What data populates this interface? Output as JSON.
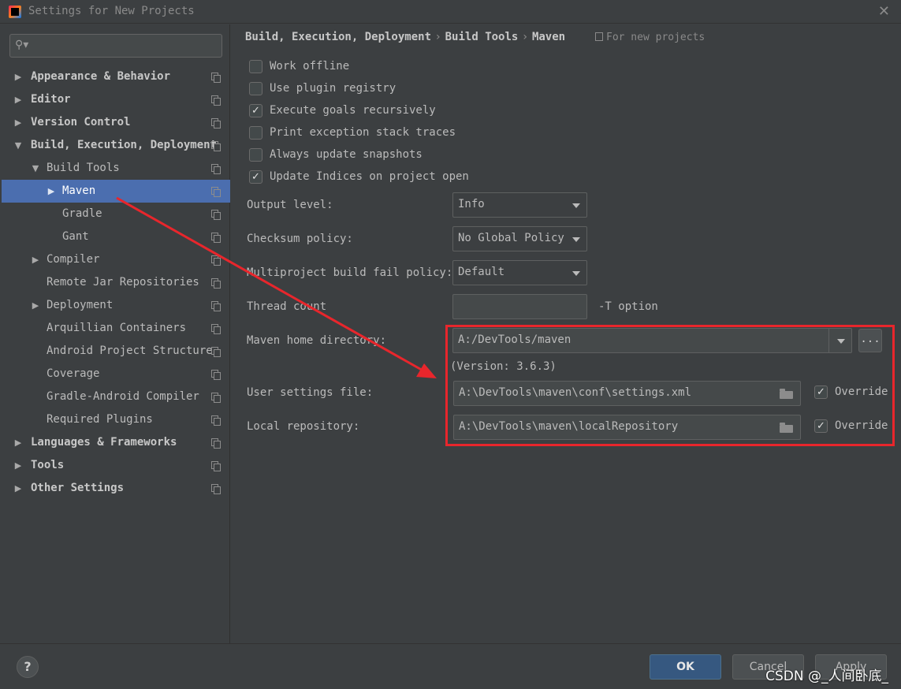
{
  "window": {
    "title": "Settings for New Projects",
    "close_glyph": "✕"
  },
  "sidebar": {
    "search_placeholder": "",
    "items": [
      {
        "label": "Appearance & Behavior",
        "arrow": "▶"
      },
      {
        "label": "Editor",
        "arrow": "▶"
      },
      {
        "label": "Version Control",
        "arrow": "▶"
      },
      {
        "label": "Build, Execution, Deployment",
        "arrow": "▼"
      },
      {
        "label": "Build Tools",
        "arrow": "▼"
      },
      {
        "label": "Maven",
        "arrow": "▶"
      },
      {
        "label": "Gradle",
        "arrow": ""
      },
      {
        "label": "Gant",
        "arrow": ""
      },
      {
        "label": "Compiler",
        "arrow": "▶"
      },
      {
        "label": "Remote Jar Repositories",
        "arrow": ""
      },
      {
        "label": "Deployment",
        "arrow": "▶"
      },
      {
        "label": "Arquillian Containers",
        "arrow": ""
      },
      {
        "label": "Android Project Structure",
        "arrow": ""
      },
      {
        "label": "Coverage",
        "arrow": ""
      },
      {
        "label": "Gradle-Android Compiler",
        "arrow": ""
      },
      {
        "label": "Required Plugins",
        "arrow": ""
      },
      {
        "label": "Languages & Frameworks",
        "arrow": "▶"
      },
      {
        "label": "Tools",
        "arrow": "▶"
      },
      {
        "label": "Other Settings",
        "arrow": "▶"
      }
    ],
    "selected": "Maven"
  },
  "breadcrumb": {
    "parts": [
      "Build, Execution, Deployment",
      "Build Tools",
      "Maven"
    ],
    "separator": "›",
    "scope": "For new projects"
  },
  "checkboxes": [
    {
      "label": "Work offline",
      "checked": false
    },
    {
      "label": "Use plugin registry",
      "checked": false
    },
    {
      "label": "Execute goals recursively",
      "checked": true
    },
    {
      "label": "Print exception stack traces",
      "checked": false
    },
    {
      "label": "Always update snapshots",
      "checked": false
    },
    {
      "label": "Update Indices on project open",
      "checked": true
    }
  ],
  "check_glyph": "✓",
  "fields": {
    "output_level": {
      "label": "Output level:",
      "value": "Info"
    },
    "checksum_policy": {
      "label": "Checksum policy:",
      "value": "No Global Policy"
    },
    "multiproject_fail": {
      "label": "Multiproject build fail policy:",
      "value": "Default"
    },
    "thread_count": {
      "label": "Thread count",
      "value": "",
      "suffix": "-T option"
    },
    "maven_home": {
      "label": "Maven home directory:",
      "value": "A:/DevTools/maven",
      "browse_label": "...",
      "version": "(Version: 3.6.3)"
    },
    "user_settings": {
      "label": "User settings file:",
      "value": "A:\\DevTools\\maven\\conf\\settings.xml",
      "override_label": "Override",
      "override": true
    },
    "local_repo": {
      "label": "Local repository:",
      "value": "A:\\DevTools\\maven\\localRepository",
      "override_label": "Override",
      "override": true
    }
  },
  "footer": {
    "help_label": "?",
    "ok_label": "OK",
    "cancel_label": "Cancel",
    "apply_label": "Apply"
  },
  "watermark": "CSDN @_人间卧底_",
  "colors": {
    "background": "#3c3f41",
    "selection": "#4b6eaf",
    "highlight": "#e8262c",
    "primary_button": "#365880"
  }
}
